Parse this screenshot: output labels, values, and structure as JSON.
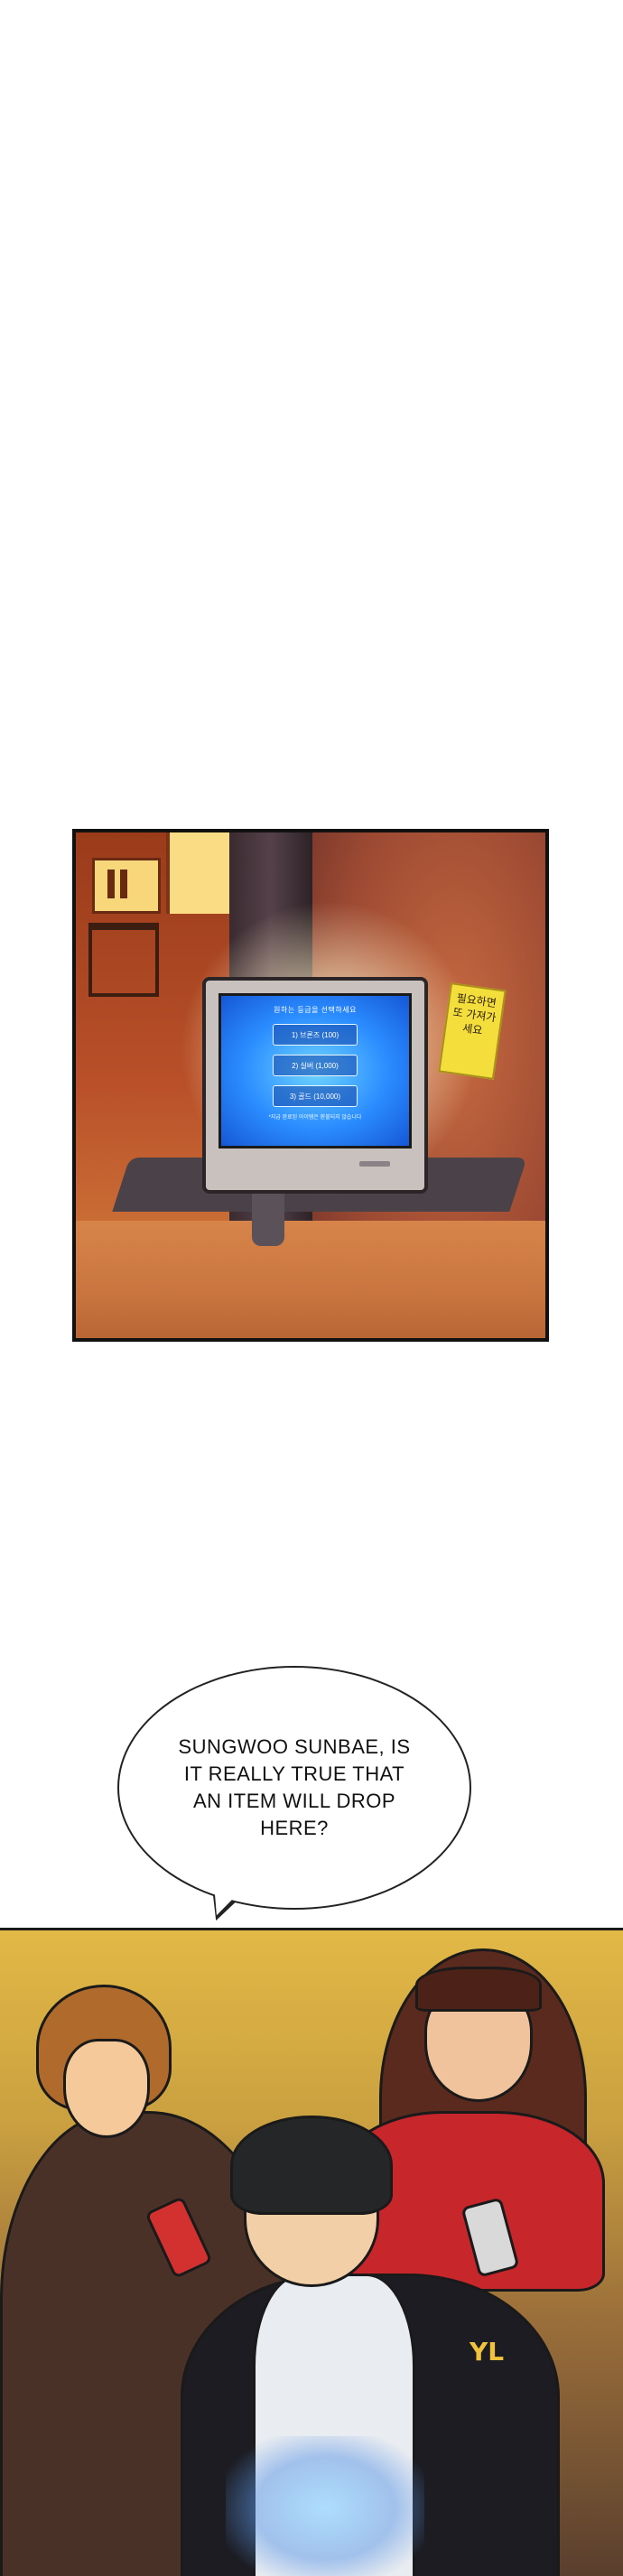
{
  "kiosk": {
    "screen_title": "원하는 등급을 선택하세요",
    "options": [
      "1) 브론즈 (100)",
      "2) 실버 (1,000)",
      "3) 골드 (10,000)"
    ],
    "note": "*지급 완료된 아이템은 환불되지 않습니다",
    "sticky_note": "필요하면 또 가져가세요"
  },
  "speech": {
    "text": "SUNGWOO SUNBAE, IS IT REALLY TRUE THAT AN ITEM WILL DROP HERE?"
  },
  "characters": {
    "badge": "YL"
  }
}
